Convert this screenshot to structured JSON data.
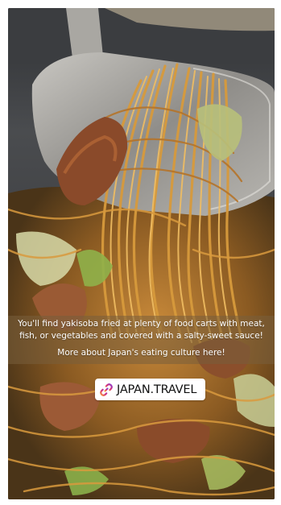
{
  "story": {
    "caption_lines": [
      "You'll find yakisoba fried at plenty of food carts with meat,",
      "fish, or vegetables and covered with a salty-sweet sauce!",
      "More about Japan's eating culture here!"
    ],
    "link_sticker": {
      "label": "JAPAN.TRAVEL",
      "icon": "link-icon"
    },
    "image_subject": "yakisoba-noodles-photo"
  },
  "colors": {
    "caption_band": "#7a603c",
    "sticker_bg": "#ffffff",
    "link_icon_gradient": [
      "#f9a23a",
      "#d62f7a",
      "#8a3fd1"
    ]
  }
}
